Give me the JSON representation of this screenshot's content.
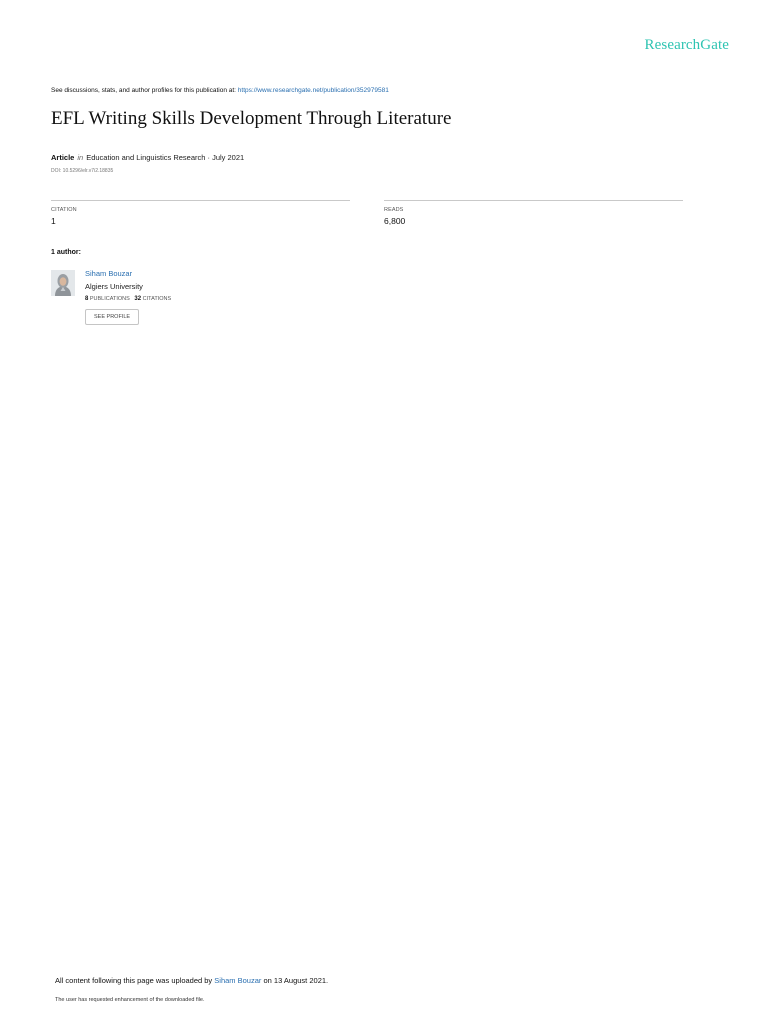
{
  "brand": "ResearchGate",
  "header": {
    "discussions_text": "See discussions, stats, and author profiles for this publication at: ",
    "publication_url": "https://www.researchgate.net/publication/352979581"
  },
  "article": {
    "title": "EFL Writing Skills Development Through Literature",
    "type": "Article",
    "in_word": "in",
    "venue": "Education and Linguistics Research · July 2021",
    "doi": "DOI: 10.5296/elr.v7i2.18835"
  },
  "stats": {
    "citation_label": "CITATION",
    "citation_value": "1",
    "reads_label": "READS",
    "reads_value": "6,800"
  },
  "authors": {
    "heading": "1 author:",
    "list": [
      {
        "name": "Siham Bouzar",
        "affiliation": "Algiers University",
        "publications_count": "8",
        "publications_label": "PUBLICATIONS",
        "citations_count": "32",
        "citations_label": "CITATIONS",
        "profile_button": "SEE PROFILE"
      }
    ]
  },
  "footer": {
    "upload_prefix": "All content following this page was uploaded by ",
    "uploader": "Siham Bouzar",
    "upload_suffix": " on 13 August 2021.",
    "enhancement_note": "The user has requested enhancement of the downloaded file."
  },
  "colors": {
    "brand": "#2fc4b2",
    "link": "#2a6fb0"
  }
}
